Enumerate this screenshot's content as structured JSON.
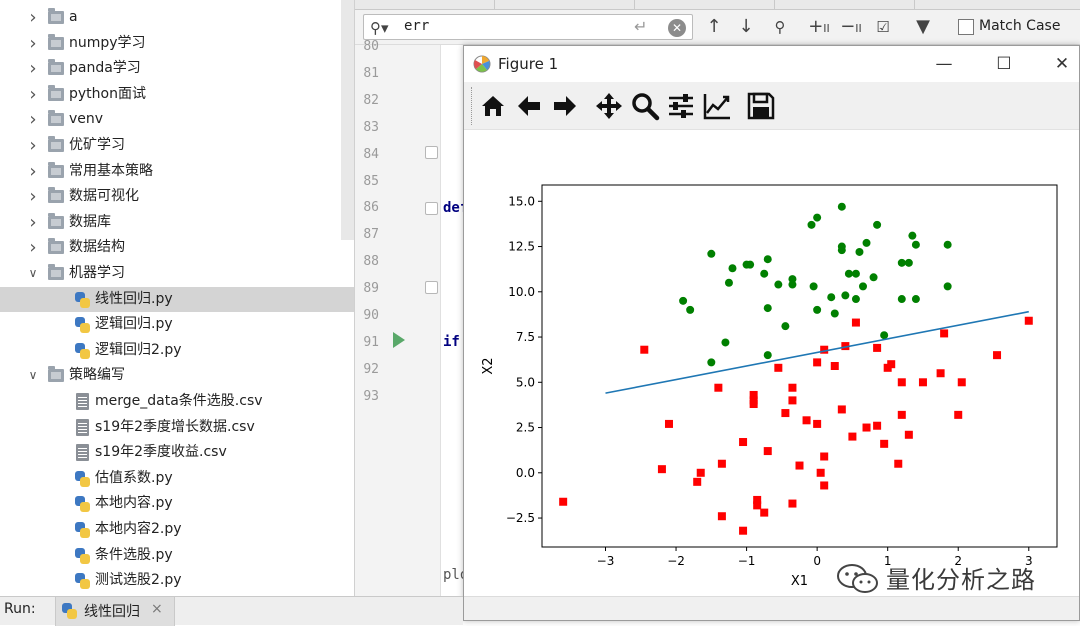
{
  "project_tree": {
    "items": [
      {
        "label": "a",
        "kind": "folder",
        "expanded": false,
        "depth": 0
      },
      {
        "label": "numpy学习",
        "kind": "folder",
        "expanded": false,
        "depth": 0
      },
      {
        "label": "panda学习",
        "kind": "folder",
        "expanded": false,
        "depth": 0
      },
      {
        "label": "python面试",
        "kind": "folder",
        "expanded": false,
        "depth": 0
      },
      {
        "label": "venv",
        "kind": "folder",
        "expanded": false,
        "depth": 0
      },
      {
        "label": "优矿学习",
        "kind": "folder",
        "expanded": false,
        "depth": 0
      },
      {
        "label": "常用基本策略",
        "kind": "folder",
        "expanded": false,
        "depth": 0
      },
      {
        "label": "数据可视化",
        "kind": "folder",
        "expanded": false,
        "depth": 0
      },
      {
        "label": "数据库",
        "kind": "folder",
        "expanded": false,
        "depth": 0
      },
      {
        "label": "数据结构",
        "kind": "folder",
        "expanded": false,
        "depth": 0
      },
      {
        "label": "机器学习",
        "kind": "folder",
        "expanded": true,
        "depth": 0
      },
      {
        "label": "线性回归.py",
        "kind": "py",
        "depth": 1,
        "selected": true
      },
      {
        "label": "逻辑回归.py",
        "kind": "py",
        "depth": 1
      },
      {
        "label": "逻辑回归2.py",
        "kind": "py",
        "depth": 1
      },
      {
        "label": "策略编写",
        "kind": "folder",
        "expanded": true,
        "depth": 0
      },
      {
        "label": "merge_data条件选股.csv",
        "kind": "csv",
        "depth": 1
      },
      {
        "label": "s19年2季度增长数据.csv",
        "kind": "csv",
        "depth": 1
      },
      {
        "label": "s19年2季度收益.csv",
        "kind": "csv",
        "depth": 1
      },
      {
        "label": "估值系数.py",
        "kind": "py",
        "depth": 1
      },
      {
        "label": "本地内容.py",
        "kind": "py",
        "depth": 1
      },
      {
        "label": "本地内容2.py",
        "kind": "py",
        "depth": 1
      },
      {
        "label": "条件选股.py",
        "kind": "py",
        "depth": 1
      },
      {
        "label": "测试选股2.py",
        "kind": "py",
        "depth": 1
      }
    ]
  },
  "search": {
    "query": "err",
    "match_case_label": "Match Case",
    "match_case_checked": false,
    "icons": [
      "search-icon",
      "enter-icon",
      "clear-icon",
      "arrow-up-icon",
      "arrow-down-icon",
      "find-all-icon",
      "add-occurrence-icon",
      "remove-occurrence-icon",
      "select-all-occurrences-icon",
      "filter-icon"
    ]
  },
  "editor": {
    "line_numbers": [
      "80",
      "81",
      "82",
      "83",
      "84",
      "85",
      "86",
      "87",
      "88",
      "89",
      "90",
      "91",
      "92",
      "93"
    ],
    "code_line_86": "def",
    "code_line_91": "if",
    "code_fragment": "plo",
    "run_line": "91"
  },
  "figure": {
    "title": "Figure 1",
    "window_buttons": [
      "minimize-icon",
      "maximize-icon",
      "close-icon"
    ],
    "toolbar_icons": [
      "home-icon",
      "back-icon",
      "forward-icon",
      "pan-icon",
      "zoom-icon",
      "subplots-icon",
      "edit-axis-icon",
      "save-icon"
    ]
  },
  "chart_data": {
    "type": "scatter",
    "title": "",
    "xlabel": "X1",
    "ylabel": "X2",
    "xlim": [
      -3.9,
      3.4
    ],
    "ylim": [
      -4.1,
      15.9
    ],
    "xticks": [
      -3,
      -2,
      -1,
      0,
      1,
      2,
      3
    ],
    "yticks": [
      -2.5,
      0.0,
      2.5,
      5.0,
      7.5,
      10.0,
      12.5,
      15.0
    ],
    "xtick_labels": [
      "−3",
      "−2",
      "−1",
      "0",
      "1",
      "2",
      "3"
    ],
    "ytick_labels": [
      "−2.5",
      "0.0",
      "2.5",
      "5.0",
      "7.5",
      "10.0",
      "12.5",
      "15.0"
    ],
    "grid": false,
    "colors": {
      "series_green": "#008000",
      "series_red": "#ff0000",
      "line": "#1f77b4"
    },
    "series": [
      {
        "marker": "circle",
        "color": "#008000",
        "points": [
          [
            0.35,
            14.7
          ],
          [
            0.0,
            14.1
          ],
          [
            -0.08,
            13.7
          ],
          [
            0.85,
            13.7
          ],
          [
            1.35,
            13.1
          ],
          [
            0.7,
            12.7
          ],
          [
            1.4,
            12.6
          ],
          [
            1.85,
            12.6
          ],
          [
            0.35,
            12.5
          ],
          [
            0.35,
            12.3
          ],
          [
            0.6,
            12.2
          ],
          [
            -1.5,
            12.1
          ],
          [
            -0.95,
            11.5
          ],
          [
            -0.7,
            11.8
          ],
          [
            1.2,
            11.6
          ],
          [
            1.3,
            11.6
          ],
          [
            -1.2,
            11.3
          ],
          [
            -1.0,
            11.5
          ],
          [
            -0.75,
            11.0
          ],
          [
            0.45,
            11.0
          ],
          [
            0.55,
            11.0
          ],
          [
            0.8,
            10.8
          ],
          [
            -0.35,
            10.7
          ],
          [
            -0.55,
            10.4
          ],
          [
            -1.25,
            10.5
          ],
          [
            -0.35,
            10.4
          ],
          [
            -0.05,
            10.3
          ],
          [
            0.65,
            10.3
          ],
          [
            1.85,
            10.3
          ],
          [
            0.4,
            9.8
          ],
          [
            0.2,
            9.7
          ],
          [
            0.55,
            9.6
          ],
          [
            1.4,
            9.6
          ],
          [
            1.2,
            9.6
          ],
          [
            -1.9,
            9.5
          ],
          [
            -1.8,
            9.0
          ],
          [
            -0.7,
            9.1
          ],
          [
            0.0,
            9.0
          ],
          [
            0.25,
            8.8
          ],
          [
            -0.45,
            8.1
          ],
          [
            0.95,
            7.6
          ],
          [
            -1.3,
            7.2
          ],
          [
            -0.7,
            6.5
          ],
          [
            -1.5,
            6.1
          ]
        ]
      },
      {
        "marker": "square",
        "color": "#ff0000",
        "points": [
          [
            3.0,
            8.4
          ],
          [
            0.55,
            8.3
          ],
          [
            1.8,
            7.7
          ],
          [
            0.85,
            6.9
          ],
          [
            0.1,
            6.8
          ],
          [
            0.4,
            7.0
          ],
          [
            -2.45,
            6.8
          ],
          [
            2.55,
            6.5
          ],
          [
            1.05,
            6.0
          ],
          [
            1.0,
            5.8
          ],
          [
            0.0,
            6.1
          ],
          [
            0.25,
            5.9
          ],
          [
            -0.55,
            5.8
          ],
          [
            1.75,
            5.5
          ],
          [
            -1.4,
            4.7
          ],
          [
            -0.35,
            4.7
          ],
          [
            1.2,
            5.0
          ],
          [
            1.5,
            5.0
          ],
          [
            2.05,
            5.0
          ],
          [
            -0.9,
            4.3
          ],
          [
            -0.9,
            4.0
          ],
          [
            -0.35,
            4.0
          ],
          [
            -0.9,
            3.8
          ],
          [
            -0.45,
            3.3
          ],
          [
            0.35,
            3.5
          ],
          [
            1.2,
            3.2
          ],
          [
            2.0,
            3.2
          ],
          [
            -0.15,
            2.9
          ],
          [
            0.0,
            2.7
          ],
          [
            0.7,
            2.5
          ],
          [
            0.85,
            2.6
          ],
          [
            -2.1,
            2.7
          ],
          [
            1.3,
            2.1
          ],
          [
            0.5,
            2.0
          ],
          [
            0.95,
            1.6
          ],
          [
            -1.05,
            1.7
          ],
          [
            -0.7,
            1.2
          ],
          [
            0.1,
            0.9
          ],
          [
            -1.35,
            0.5
          ],
          [
            -0.25,
            0.4
          ],
          [
            1.15,
            0.5
          ],
          [
            -2.2,
            0.2
          ],
          [
            -1.65,
            0.0
          ],
          [
            0.05,
            0.0
          ],
          [
            -1.7,
            -0.5
          ],
          [
            0.1,
            -0.7
          ],
          [
            -3.6,
            -1.6
          ],
          [
            -0.85,
            -1.5
          ],
          [
            -0.35,
            -1.7
          ],
          [
            -0.85,
            -1.8
          ],
          [
            -0.75,
            -2.2
          ],
          [
            -1.35,
            -2.4
          ],
          [
            -1.05,
            -3.2
          ]
        ]
      }
    ],
    "line": {
      "x": [
        -3.0,
        3.0
      ],
      "y": [
        4.4,
        8.9
      ],
      "color": "#1f77b4"
    }
  },
  "run_bar": {
    "label": "Run:",
    "tab_label": "线性回归",
    "tab_close": "×"
  },
  "watermark": {
    "text": "量化分析之路"
  }
}
